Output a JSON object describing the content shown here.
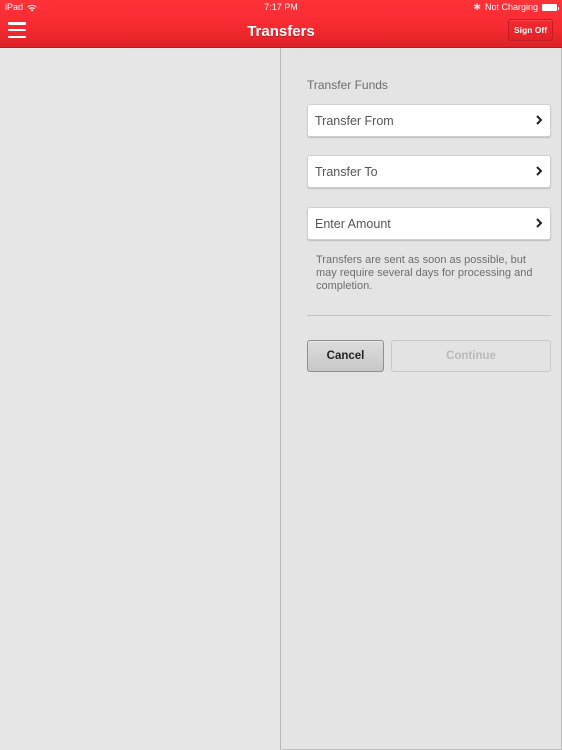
{
  "status_bar": {
    "device": "iPad",
    "time": "7:17 PM",
    "charging_status": "Not Charging",
    "icons": [
      "wifi-icon",
      "bluetooth-icon",
      "battery-icon"
    ]
  },
  "nav_bar": {
    "title": "Transfers",
    "menu_icon": "hamburger-menu-icon",
    "sign_off_label": "Sign Off"
  },
  "transfer_form": {
    "section_label": "Transfer Funds",
    "fields": [
      {
        "label": "Transfer From",
        "icon": "chevron-right-icon"
      },
      {
        "label": "Transfer To",
        "icon": "chevron-right-icon"
      },
      {
        "label": "Enter Amount",
        "icon": "chevron-right-icon"
      }
    ],
    "note": "Transfers are sent as soon as possible, but may require several days for processing and completion.",
    "cancel_label": "Cancel",
    "continue_label": "Continue",
    "continue_enabled": false
  },
  "colors": {
    "brand_red": "#f52a30",
    "background": "#e4e4e4"
  }
}
